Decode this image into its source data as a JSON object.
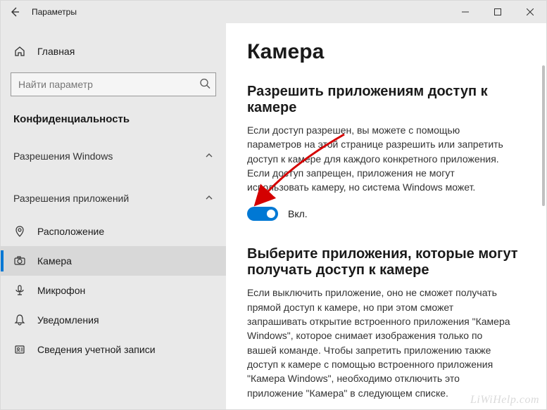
{
  "window": {
    "title": "Параметры"
  },
  "sidebar": {
    "home": "Главная",
    "search_placeholder": "Найти параметр",
    "section": "Конфиденциальность",
    "group1": "Разрешения Windows",
    "group2": "Разрешения приложений",
    "items": [
      {
        "label": "Расположение"
      },
      {
        "label": "Камера"
      },
      {
        "label": "Микрофон"
      },
      {
        "label": "Уведомления"
      },
      {
        "label": "Сведения учетной записи"
      }
    ]
  },
  "content": {
    "title": "Камера",
    "sect1_heading": "Разрешить приложениям доступ к камере",
    "sect1_desc": "Если доступ разрешен, вы можете с помощью параметров на этой странице разрешить или запретить доступ к камере для каждого конкретного приложения. Если доступ запрещен, приложения не могут использовать камеру, но система Windows может.",
    "toggle_label": "Вкл.",
    "sect2_heading": "Выберите приложения, которые могут получать доступ к камере",
    "sect2_desc": "Если выключить приложение, оно не сможет получать прямой доступ к камере, но при этом сможет запрашивать открытие встроенного приложения \"Камера Windows\", которое снимает изображения только по вашей команде. Чтобы запретить приложению также доступ к камере с помощью встроенного приложения \"Камера Windows\", необходимо отключить это приложение \"Камера\" в следующем списке."
  },
  "watermark": "LiWiHelp.com"
}
